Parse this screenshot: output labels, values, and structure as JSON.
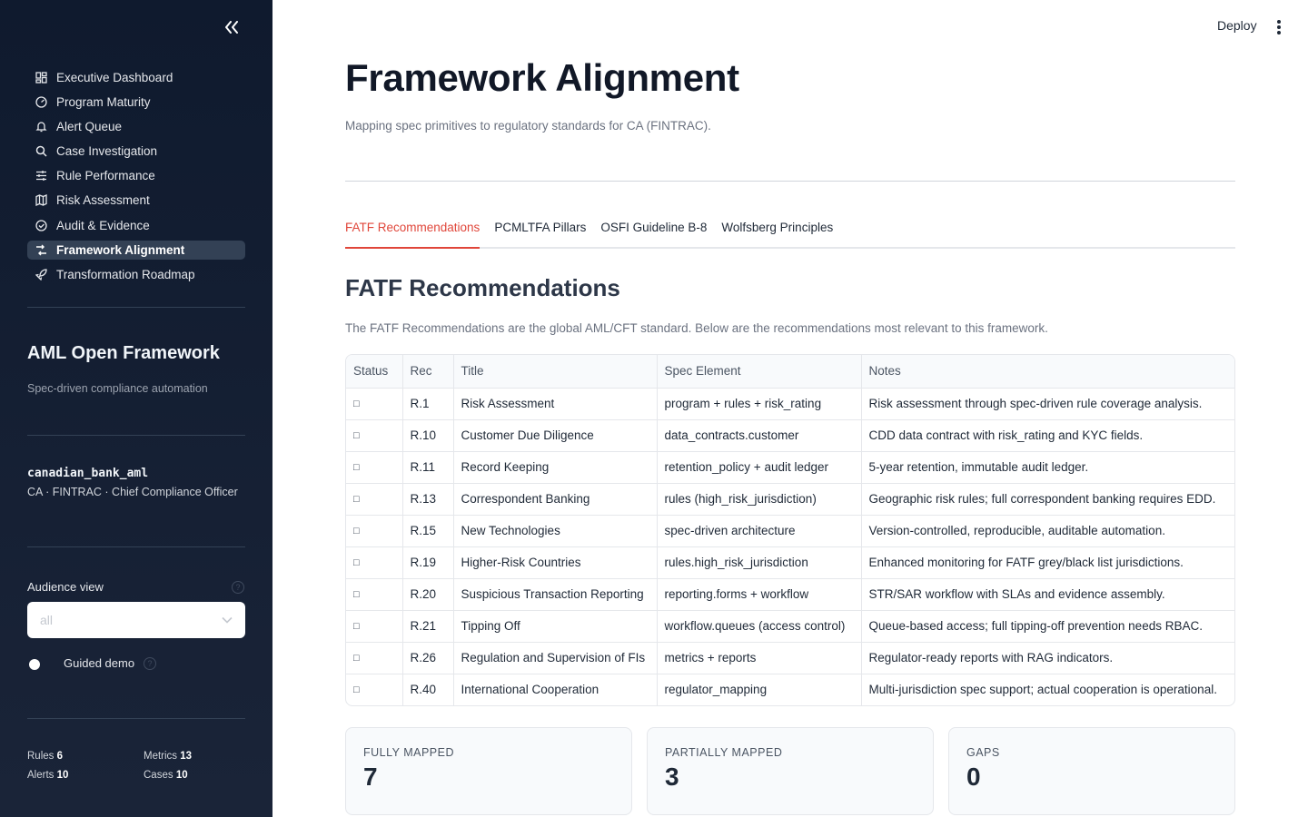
{
  "sidebar": {
    "nav": [
      {
        "label": "Executive Dashboard",
        "icon": "dashboard-icon",
        "active": false
      },
      {
        "label": "Program Maturity",
        "icon": "gauge-icon",
        "active": false
      },
      {
        "label": "Alert Queue",
        "icon": "bell-icon",
        "active": false
      },
      {
        "label": "Case Investigation",
        "icon": "search-icon",
        "active": false
      },
      {
        "label": "Rule Performance",
        "icon": "sliders-icon",
        "active": false
      },
      {
        "label": "Risk Assessment",
        "icon": "map-icon",
        "active": false
      },
      {
        "label": "Audit & Evidence",
        "icon": "verified-badge-icon",
        "active": false
      },
      {
        "label": "Framework Alignment",
        "icon": "compare-icon",
        "active": true
      },
      {
        "label": "Transformation Roadmap",
        "icon": "rocket-icon",
        "active": false
      }
    ],
    "brand_title": "AML Open Framework",
    "brand_subtitle": "Spec-driven compliance automation",
    "org_name": "canadian_bank_aml",
    "org_meta": "CA · FINTRAC · Chief Compliance Officer",
    "audience_label": "Audience view",
    "audience_value": "all",
    "guided_demo_label": "Guided demo",
    "guided_demo_on": false,
    "stats": {
      "rules_label": "Rules",
      "rules_value": "6",
      "metrics_label": "Metrics",
      "metrics_value": "13",
      "alerts_label": "Alerts",
      "alerts_value": "10",
      "cases_label": "Cases",
      "cases_value": "10"
    }
  },
  "header": {
    "deploy_label": "Deploy"
  },
  "main": {
    "title": "Framework Alignment",
    "subtitle": "Mapping spec primitives to regulatory standards for CA (FINTRAC).",
    "tabs": [
      {
        "label": "FATF Recommendations",
        "active": true
      },
      {
        "label": "PCMLTFA Pillars",
        "active": false
      },
      {
        "label": "OSFI Guideline B-8",
        "active": false
      },
      {
        "label": "Wolfsberg Principles",
        "active": false
      }
    ],
    "section_title": "FATF Recommendations",
    "section_desc": "The FATF Recommendations are the global AML/CFT standard. Below are the recommendations most relevant to this framework.",
    "table": {
      "headers": [
        "Status",
        "Rec",
        "Title",
        "Spec Element",
        "Notes"
      ],
      "rows": [
        [
          "□",
          "R.1",
          "Risk Assessment",
          "program + rules + risk_rating",
          "Risk assessment through spec-driven rule coverage analysis."
        ],
        [
          "□",
          "R.10",
          "Customer Due Diligence",
          "data_contracts.customer",
          "CDD data contract with risk_rating and KYC fields."
        ],
        [
          "□",
          "R.11",
          "Record Keeping",
          "retention_policy + audit ledger",
          "5-year retention, immutable audit ledger."
        ],
        [
          "□",
          "R.13",
          "Correspondent Banking",
          "rules (high_risk_jurisdiction)",
          "Geographic risk rules; full correspondent banking requires EDD."
        ],
        [
          "□",
          "R.15",
          "New Technologies",
          "spec-driven architecture",
          "Version-controlled, reproducible, auditable automation."
        ],
        [
          "□",
          "R.19",
          "Higher-Risk Countries",
          "rules.high_risk_jurisdiction",
          "Enhanced monitoring for FATF grey/black list jurisdictions."
        ],
        [
          "□",
          "R.20",
          "Suspicious Transaction Reporting",
          "reporting.forms + workflow",
          "STR/SAR workflow with SLAs and evidence assembly."
        ],
        [
          "□",
          "R.21",
          "Tipping Off",
          "workflow.queues (access control)",
          "Queue-based access; full tipping-off prevention needs RBAC."
        ],
        [
          "□",
          "R.26",
          "Regulation and Supervision of FIs",
          "metrics + reports",
          "Regulator-ready reports with RAG indicators."
        ],
        [
          "□",
          "R.40",
          "International Cooperation",
          "regulator_mapping",
          "Multi-jurisdiction spec support; actual cooperation is operational."
        ]
      ]
    },
    "cards": [
      {
        "label": "FULLY MAPPED",
        "value": "7"
      },
      {
        "label": "PARTIALLY MAPPED",
        "value": "3"
      },
      {
        "label": "GAPS",
        "value": "0"
      }
    ]
  },
  "colors": {
    "sidebar_bg": "#0f1a2e",
    "accent": "#e0463a",
    "active_nav_bg": "#334155"
  }
}
